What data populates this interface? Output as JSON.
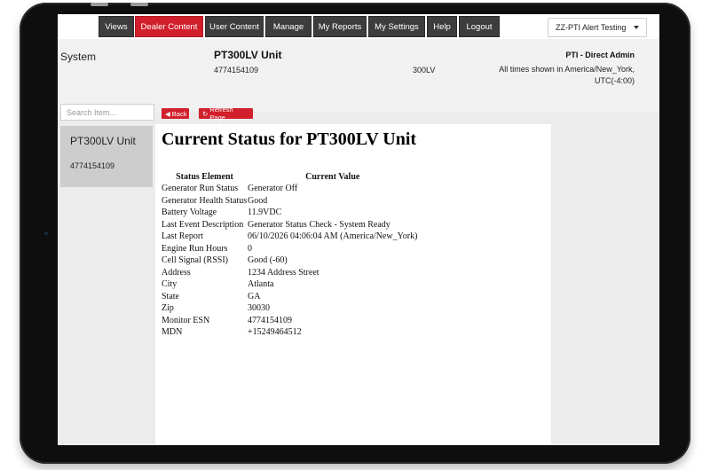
{
  "nav": {
    "items": [
      {
        "label": "Views",
        "active": false
      },
      {
        "label": "Dealer Content",
        "active": true
      },
      {
        "label": "User Content",
        "active": false
      },
      {
        "label": "Manage",
        "active": false
      },
      {
        "label": "My Reports",
        "active": false
      },
      {
        "label": "My Settings",
        "active": false
      },
      {
        "label": "Help",
        "active": false
      },
      {
        "label": "Logout",
        "active": false
      }
    ],
    "org_select": "ZZ-PTI Alert Testing"
  },
  "header": {
    "section": "System",
    "unit_name": "PT300LV Unit",
    "unit_esn": "4774154109",
    "model": "300LV",
    "role": "PTI - Direct Admin",
    "timezone_note": "All times shown in America/New_York, UTC(-4:00)"
  },
  "sidebar": {
    "search_placeholder": "Search Item...",
    "card_title": "PT300LV Unit",
    "card_esn": "4774154109"
  },
  "actions": {
    "back": "Back",
    "refresh": "Refresh Page"
  },
  "status": {
    "title": "Current Status for PT300LV Unit",
    "col_element": "Status Element",
    "col_value": "Current Value",
    "rows": [
      {
        "k": "Generator Run Status",
        "v": "Generator Off"
      },
      {
        "k": "Generator Health Status",
        "v": "Good"
      },
      {
        "k": "Battery Voltage",
        "v": "11.9VDC"
      },
      {
        "k": "Last Event Description",
        "v": "Generator Status Check - System Ready"
      },
      {
        "k": "Last Report",
        "v": "06/10/2026 04:06:04 AM (America/New_York)"
      },
      {
        "k": "Engine Run Hours",
        "v": "0"
      },
      {
        "k": "Cell Signal (RSSI)",
        "v": "Good (-60)"
      },
      {
        "k": "Address",
        "v": "1234 Address Street"
      },
      {
        "k": "City",
        "v": "Atlanta"
      },
      {
        "k": "State",
        "v": "GA"
      },
      {
        "k": "Zip",
        "v": "30030"
      },
      {
        "k": "Monitor ESN",
        "v": "4774154109"
      },
      {
        "k": "MDN",
        "v": "+15249464512"
      }
    ]
  },
  "colors": {
    "accent": "#d11f2b",
    "nav_bg": "#3d3d3d",
    "card_bg": "#cdcdcd"
  }
}
